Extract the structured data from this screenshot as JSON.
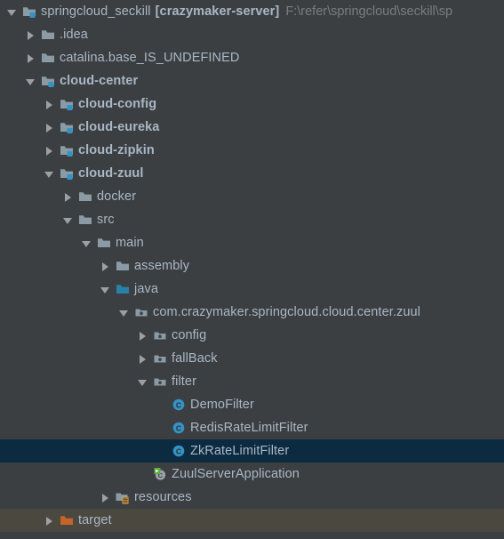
{
  "theme": {
    "background": "#3c3f41",
    "text": "#a9b7c6",
    "muted_text": "#787d80",
    "selection_background": "#0d2b40",
    "excluded_background": "#4a483f",
    "folder_gray": "#8a9ba5",
    "folder_blue": "#2a80a8",
    "folder_orange": "#c4642a",
    "badge_blue": "#3592c4",
    "badge_orange": "#e8a33d",
    "class_icon_blue": "#3592c4",
    "run_green": "#5fad3f",
    "arrow": "#9aa0a3"
  },
  "project_tree": {
    "root": {
      "name": "springcloud_seckill",
      "module_tag": "[crazymaker-server]",
      "path": "F:\\refer\\springcloud\\seckill\\sp"
    },
    "rows": [
      {
        "label": "springcloud_seckill",
        "module_tag": "[crazymaker-server]",
        "path": "F:\\refer\\springcloud\\seckill\\sp",
        "depth": 0,
        "arrow": "expanded",
        "icon": "module-folder-icon",
        "bold": false,
        "state": "normal"
      },
      {
        "label": ".idea",
        "depth": 1,
        "arrow": "collapsed",
        "icon": "folder-icon",
        "bold": false,
        "state": "normal"
      },
      {
        "label": "catalina.base_IS_UNDEFINED",
        "depth": 1,
        "arrow": "collapsed",
        "icon": "folder-icon",
        "bold": false,
        "state": "normal"
      },
      {
        "label": "cloud-center",
        "depth": 1,
        "arrow": "expanded",
        "icon": "module-folder-icon",
        "bold": true,
        "state": "normal"
      },
      {
        "label": "cloud-config",
        "depth": 2,
        "arrow": "collapsed",
        "icon": "module-folder-icon",
        "bold": true,
        "state": "normal"
      },
      {
        "label": "cloud-eureka",
        "depth": 2,
        "arrow": "collapsed",
        "icon": "module-folder-icon",
        "bold": true,
        "state": "normal"
      },
      {
        "label": "cloud-zipkin",
        "depth": 2,
        "arrow": "collapsed",
        "icon": "module-folder-icon",
        "bold": true,
        "state": "normal"
      },
      {
        "label": "cloud-zuul",
        "depth": 2,
        "arrow": "expanded",
        "icon": "module-folder-icon",
        "bold": true,
        "state": "normal"
      },
      {
        "label": "docker",
        "depth": 3,
        "arrow": "collapsed",
        "icon": "folder-icon",
        "bold": false,
        "state": "normal"
      },
      {
        "label": "src",
        "depth": 3,
        "arrow": "expanded",
        "icon": "folder-icon",
        "bold": false,
        "state": "normal"
      },
      {
        "label": "main",
        "depth": 4,
        "arrow": "expanded",
        "icon": "folder-icon",
        "bold": false,
        "state": "normal"
      },
      {
        "label": "assembly",
        "depth": 5,
        "arrow": "collapsed",
        "icon": "folder-icon",
        "bold": false,
        "state": "normal"
      },
      {
        "label": "java",
        "depth": 5,
        "arrow": "expanded",
        "icon": "source-root-folder-icon",
        "bold": false,
        "state": "normal"
      },
      {
        "label": "com.crazymaker.springcloud.cloud.center.zuul",
        "depth": 6,
        "arrow": "expanded",
        "icon": "package-icon",
        "bold": false,
        "state": "normal"
      },
      {
        "label": "config",
        "depth": 7,
        "arrow": "collapsed",
        "icon": "package-icon",
        "bold": false,
        "state": "normal"
      },
      {
        "label": "fallBack",
        "depth": 7,
        "arrow": "collapsed",
        "icon": "package-icon",
        "bold": false,
        "state": "normal"
      },
      {
        "label": "filter",
        "depth": 7,
        "arrow": "expanded",
        "icon": "package-icon",
        "bold": false,
        "state": "normal"
      },
      {
        "label": "DemoFilter",
        "depth": 8,
        "arrow": "none",
        "icon": "java-class-icon",
        "bold": false,
        "state": "normal"
      },
      {
        "label": "RedisRateLimitFilter",
        "depth": 8,
        "arrow": "none",
        "icon": "java-class-icon",
        "bold": false,
        "state": "normal"
      },
      {
        "label": "ZkRateLimitFilter",
        "depth": 8,
        "arrow": "none",
        "icon": "java-class-icon",
        "bold": false,
        "state": "selected"
      },
      {
        "label": "ZuulServerApplication",
        "depth": 7,
        "arrow": "none",
        "icon": "runnable-class-icon",
        "bold": false,
        "state": "normal"
      },
      {
        "label": "resources",
        "depth": 5,
        "arrow": "collapsed",
        "icon": "resources-folder-icon",
        "bold": false,
        "state": "normal"
      },
      {
        "label": "target",
        "depth": 2,
        "arrow": "collapsed",
        "icon": "excluded-folder-icon",
        "bold": false,
        "state": "excluded"
      }
    ]
  }
}
